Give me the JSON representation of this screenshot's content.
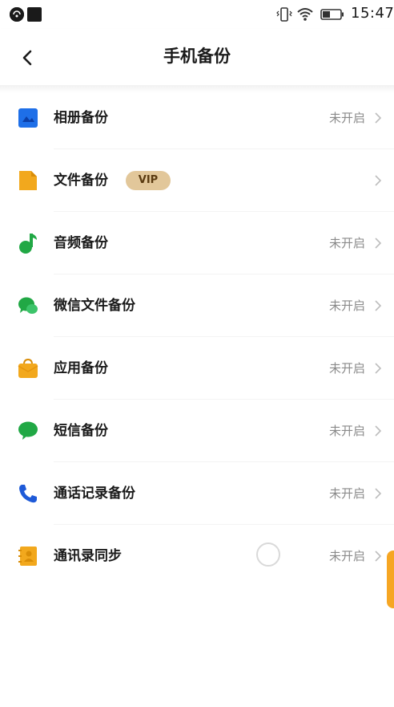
{
  "status_bar": {
    "time": "15:47",
    "icons": [
      "notification-icon",
      "app-icon",
      "vibrate-icon",
      "wifi-icon",
      "battery-icon"
    ]
  },
  "header": {
    "title": "手机备份",
    "back_icon": "back-arrow-icon"
  },
  "items": [
    {
      "label": "相册备份",
      "status": "未开启",
      "icon": "album-icon",
      "icon_color": "#1e6fe8"
    },
    {
      "label": "文件备份",
      "status": "",
      "badge": "VIP",
      "icon": "file-icon",
      "icon_color": "#f2a81d"
    },
    {
      "label": "音频备份",
      "status": "未开启",
      "icon": "music-note-icon",
      "icon_color": "#21a845"
    },
    {
      "label": "微信文件备份",
      "status": "未开启",
      "icon": "wechat-icon",
      "icon_color": "#21a845"
    },
    {
      "label": "应用备份",
      "status": "未开启",
      "icon": "app-bag-icon",
      "icon_color": "#f2a81d"
    },
    {
      "label": "短信备份",
      "status": "未开启",
      "icon": "message-bubble-icon",
      "icon_color": "#21a845"
    },
    {
      "label": "通话记录备份",
      "status": "未开启",
      "icon": "phone-icon",
      "icon_color": "#1e5ad8"
    },
    {
      "label": "通讯录同步",
      "status": "未开启",
      "icon": "contacts-book-icon",
      "icon_color": "#f2a81d"
    }
  ],
  "colors": {
    "accent_orange": "#f6a623",
    "vip_badge_bg": "#e2c79a",
    "status_text": "#8a8a8a"
  }
}
